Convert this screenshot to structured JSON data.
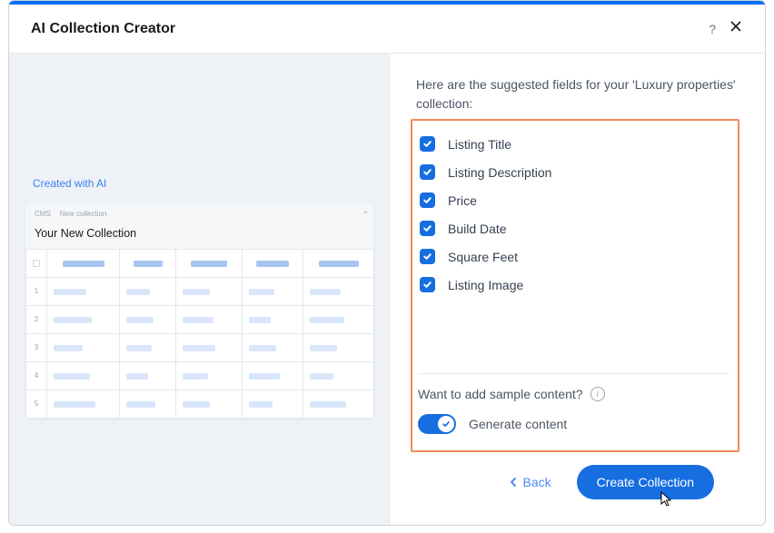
{
  "header": {
    "title": "AI Collection Creator"
  },
  "left": {
    "ai_badge": "Created with AI",
    "preview": {
      "tab1": "CMS",
      "tab2": "New collection",
      "title": "Your New Collection"
    }
  },
  "right": {
    "intro": "Here are the suggested fields for your 'Luxury properties' collection:",
    "fields": [
      {
        "label": "Listing Title",
        "checked": true
      },
      {
        "label": "Listing Description",
        "checked": true
      },
      {
        "label": "Price",
        "checked": true
      },
      {
        "label": "Build Date",
        "checked": true
      },
      {
        "label": "Square Feet",
        "checked": true
      },
      {
        "label": "Listing Image",
        "checked": true
      }
    ],
    "sample_prompt": "Want to add sample content?",
    "toggle_label": "Generate content",
    "toggle_on": true
  },
  "footer": {
    "back_label": "Back",
    "create_label": "Create Collection"
  }
}
